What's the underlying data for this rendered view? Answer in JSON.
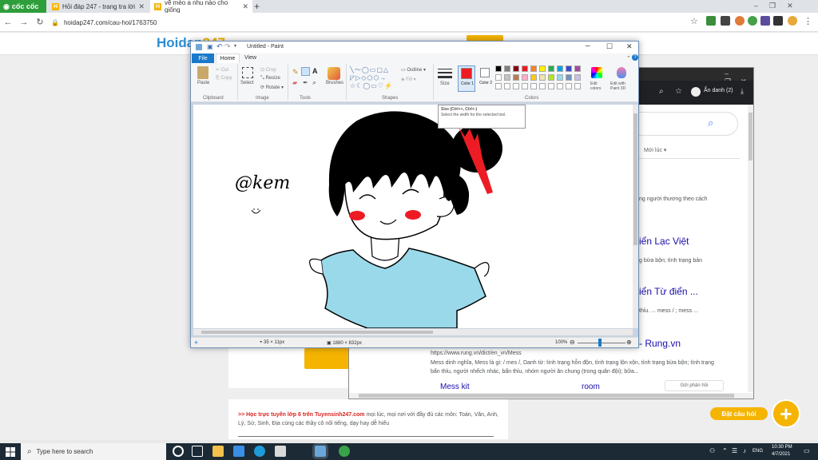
{
  "browser": {
    "brand": "cốc cốc",
    "tabs": [
      {
        "label": "Hỏi đáp 247 - trang tra lời"
      },
      {
        "label": "vẽ mèo a nhu nào cho giống"
      }
    ],
    "url": "hoidap247.com/cau-hoi/1763750"
  },
  "site": {
    "logo_main": "Hoidap",
    "logo_accent": "247",
    "promo_link": ">> Học trực tuyến lớp 6 trên Tuyensinh247.com",
    "promo_text": "mọi lúc, mọi nơi với đầy đủ các môn: Toán, Văn, Anh, Lý, Sử, Sinh, Địa cùng các thầy cô nổi tiếng, dạy hay dễ hiểu",
    "ask_label": "Đặt câu hỏi"
  },
  "search": {
    "account": "Ẩn danh (2)",
    "filter_label": "Mới lúc",
    "snippet1": "ng người thương theo cách",
    "result1": "iển Lạc Việt",
    "snippet2": "g bừa bộn; tình trạng bản",
    "result2": "iển Từ điển ...",
    "snippet3": "thỉu. ... mess / ; mess ...",
    "result3": "- Rung.vn",
    "result3_url": "https://www.rung.vn/dict/en_vn/Mess",
    "result3_snippet": "Mess dinh nghĩa, Mess là gì: / mes /, Danh từ: tình trạng hỗn độn, tình trạng lộn xộn, tình trạng bừa bộn; tình trạng bẩn thỉu, người nhếch nhác, bẩn thỉu, nhóm người ăn chung (trong quân đội); bữa...",
    "related1": "Mess kit",
    "related2": "room",
    "feedback": "Gửi phản hồi"
  },
  "paint": {
    "title": "Untitled - Paint",
    "menu_file": "File",
    "tab_home": "Home",
    "tab_view": "View",
    "groups": {
      "clipboard": "Clipboard",
      "image": "Image",
      "tools": "Tools",
      "shapes": "Shapes",
      "colors": "Colors"
    },
    "buttons": {
      "paste": "Paste",
      "cut": "Cut",
      "copy": "Copy",
      "select": "Select",
      "crop": "Crop",
      "resize": "Resize",
      "rotate": "Rotate",
      "brushes": "Brushes",
      "outline": "Outline",
      "fill": "Fill",
      "size": "Size",
      "color1": "Color 1",
      "color2": "Color 2",
      "edit_colors": "Edit colors",
      "edit_paint3d": "Edit with Paint 3D"
    },
    "tooltip_title": "Size (Ctrl++, Ctrl+-)",
    "tooltip_body": "Select the width for the selected tool.",
    "signature": "@kem",
    "status_pos": "35 × 11px",
    "status_size": "1880 × 832px",
    "zoom": "100%",
    "palette": [
      "#000000",
      "#7f7f7f",
      "#880015",
      "#ed1c24",
      "#ff7f27",
      "#fff200",
      "#22b14c",
      "#00a2e8",
      "#3f48cc",
      "#a349a4",
      "#ffffff",
      "#c3c3c3",
      "#b97a57",
      "#ffaec9",
      "#ffc90e",
      "#efe4b0",
      "#b5e61d",
      "#99d9ea",
      "#7092be",
      "#c8bfe7"
    ],
    "color1": "#ed1c24",
    "shirt_color": "#99d9ea",
    "cheek_color": "#ed1c24"
  },
  "taskbar": {
    "search_placeholder": "Type here to search",
    "lang": "ENG",
    "time": "10:30 PM",
    "date": "4/7/2021"
  }
}
